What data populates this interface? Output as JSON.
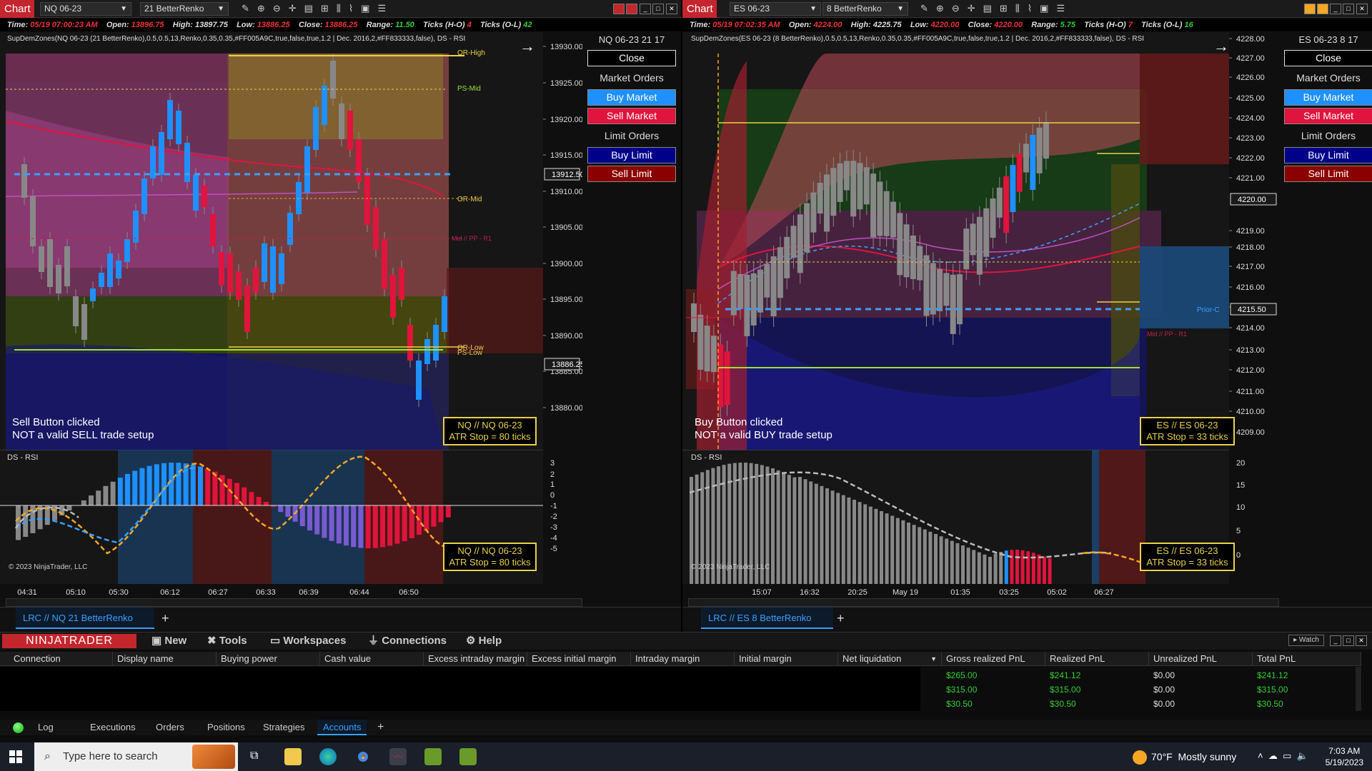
{
  "left": {
    "title_tab": "Chart",
    "instrument": "NQ 06-23",
    "bar_type": "21 BetterRenko",
    "info": {
      "time_label": "Time:",
      "time": "05/19 07:00:23 AM",
      "open_label": "Open:",
      "open": "13896.75",
      "high_label": "High:",
      "high": "13897.75",
      "low_label": "Low:",
      "low": "13886.25",
      "close_label": "Close:",
      "close": "13886.25",
      "range_label": "Range:",
      "range": "11.50",
      "ticks_hl_label": "Ticks (H-O)",
      "ticks_hl": "4",
      "ticks_ol_label": "Ticks (O-L)",
      "ticks_ol": "42"
    },
    "indicator_label": "SupDemZones(NQ 06-23 (21 BetterRenko),0.5,0.5,13,Renko,0.35,0.35,#FF005A9C,true,false,true,1.2 | Dec. 2016,2,#FF833333,false), DS - RSI",
    "price_labels": [
      "13930.00",
      "13925.00",
      "13920.00",
      "13915.00",
      "13910.00",
      "13905.00",
      "13900.00",
      "13895.00",
      "13890.00",
      "13885.00",
      "13880.00"
    ],
    "price_tags": [
      "13912.50",
      "13886.25"
    ],
    "zone_labels": {
      "orhigh": "OR-High",
      "psmid": "PS-Mid",
      "ormid": "OR-Mid",
      "mid": "Mid // PP - R1",
      "orlow": "OR-Low",
      "pslow": "PS-Low"
    },
    "message_line1": "Sell Button clicked",
    "message_line2": "NOT a valid SELL trade setup",
    "atr_line1": "NQ // NQ 06-23",
    "atr_line2": "ATR Stop = 80 ticks",
    "ind_title": "DS - RSI",
    "ind_axis": [
      "3",
      "2",
      "1",
      "0",
      "-1",
      "-2",
      "-3",
      "-4",
      "-5"
    ],
    "copyright": "© 2023 NinjaTrader, LLC",
    "time_labels": [
      "04:31",
      "05:10",
      "05:30",
      "06:12",
      "06:27",
      "06:33",
      "06:39",
      "06:44",
      "06:50"
    ],
    "panel": {
      "header": "NQ 06-23 21 17",
      "close": "Close",
      "market": "Market Orders",
      "buy_market": "Buy Market",
      "sell_market": "Sell Market",
      "limit": "Limit Orders",
      "buy_limit": "Buy Limit",
      "sell_limit": "Sell Limit"
    },
    "tab_label": "LRC // NQ  21 BetterRenko"
  },
  "right": {
    "title_tab": "Chart",
    "instrument": "ES 06-23",
    "bar_type": "8 BetterRenko",
    "info": {
      "time_label": "Time:",
      "time": "05/19 07:02:35 AM",
      "open_label": "Open:",
      "open": "4224.00",
      "high_label": "High:",
      "high": "4225.75",
      "low_label": "Low:",
      "low": "4220.00",
      "close_label": "Close:",
      "close": "4220.00",
      "range_label": "Range:",
      "range": "5.75",
      "ticks_hl_label": "Ticks (H-O)",
      "ticks_hl": "7",
      "ticks_ol_label": "Ticks (O-L)",
      "ticks_ol": "16"
    },
    "indicator_label": "SupDemZones(ES 06-23 (8 BetterRenko),0.5,0.5,13,Renko,0.35,0.35,#FF005A9C,true,false,true,1.2 | Dec. 2016,2,#FF833333,false), DS - RSI",
    "price_labels": [
      "4228.00",
      "4227.00",
      "4226.00",
      "4225.00",
      "4224.00",
      "4223.00",
      "4222.00",
      "4221.00",
      "4219.00",
      "4218.00",
      "4217.00",
      "4216.00",
      "4215.00",
      "4214.00",
      "4213.00",
      "4212.00",
      "4211.00",
      "4210.00",
      "4209.00"
    ],
    "price_tags": [
      "4220.00",
      "4215.50"
    ],
    "zone_labels": {
      "prior": "Prior-C",
      "mid": "Mid // PP - R1"
    },
    "message_line1": "Buy Button clicked",
    "message_line2": "NOT a valid BUY trade setup",
    "atr_line1": "ES // ES 06-23",
    "atr_line2": "ATR Stop = 33 ticks",
    "ind_title": "DS - RSI",
    "ind_axis": [
      "20",
      "15",
      "10",
      "5",
      "0"
    ],
    "copyright": "© 2023 NinjaTrader, LLC",
    "time_labels": [
      "15:07",
      "16:32",
      "20:25",
      "May 19",
      "01:35",
      "03:25",
      "05:02",
      "06:27"
    ],
    "panel": {
      "header": "ES 06-23 8 17",
      "close": "Close",
      "market": "Market Orders",
      "buy_market": "Buy Market",
      "sell_market": "Sell Market",
      "limit": "Limit Orders",
      "buy_limit": "Buy Limit",
      "sell_limit": "Sell Limit"
    },
    "tab_label": "LRC // ES  8 BetterRenko"
  },
  "control_center": {
    "logo": "NINJATRADER",
    "menu": [
      "New",
      "Tools",
      "Workspaces",
      "Connections",
      "Help"
    ],
    "watch": "Watch",
    "columns": [
      "Connection",
      "Display name",
      "Buying power",
      "Cash value",
      "Excess intraday margin",
      "Excess initial margin",
      "Intraday margin",
      "Initial margin",
      "Net liquidation",
      "Gross realized PnL",
      "Realized PnL",
      "Unrealized PnL",
      "Total PnL"
    ],
    "rows": [
      {
        "gross": "$265.00",
        "realized": "$241.12",
        "unrealized": "$0.00",
        "total": "$241.12"
      },
      {
        "gross": "$315.00",
        "realized": "$315.00",
        "unrealized": "$0.00",
        "total": "$315.00"
      },
      {
        "gross": "$30.50",
        "realized": "$30.50",
        "unrealized": "$0.00",
        "total": "$30.50"
      }
    ],
    "bottom_tabs": [
      "Log",
      "Executions",
      "Orders",
      "Positions",
      "Strategies",
      "Accounts"
    ],
    "active_tab": "Accounts"
  },
  "taskbar": {
    "search_placeholder": "Type here to search",
    "temp": "70°F",
    "weather": "Mostly sunny",
    "time": "7:03 AM",
    "date": "5/19/2023"
  },
  "colors": {
    "buy": "#1e90ff",
    "sell": "#e0143c",
    "buy_limit": "#00008b",
    "sell_limit": "#8b0000",
    "accent": "#c4262e"
  }
}
